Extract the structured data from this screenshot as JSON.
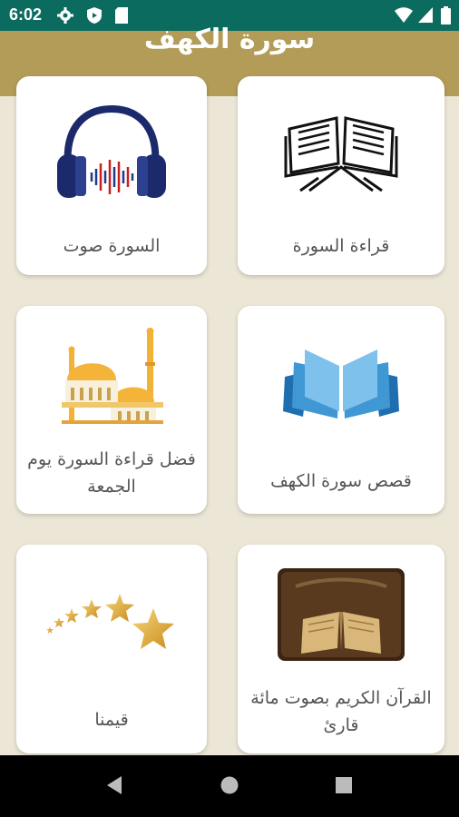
{
  "status_bar": {
    "time": "6:02",
    "left_icons": [
      "gear-icon",
      "shield-icon",
      "sd-card-icon"
    ],
    "right_icons": [
      "wifi-icon",
      "signal-icon",
      "battery-icon"
    ]
  },
  "app_bar": {
    "title": "سورة الكهف"
  },
  "cards": [
    {
      "label": "قراءة السورة",
      "icon": "quran-book-icon"
    },
    {
      "label": "السورة صوت",
      "icon": "headphones-icon"
    },
    {
      "label": "قصص سورة الكهف",
      "icon": "open-book-icon"
    },
    {
      "label": "فضل قراءة السورة يوم الجمعة",
      "icon": "mosque-icon"
    },
    {
      "label": "القرآن الكريم بصوت مائة قارئ",
      "icon": "quran-image-icon"
    },
    {
      "label": "قيمنا",
      "icon": "stars-icon"
    }
  ],
  "nav_bar": {
    "icons": [
      "back-icon",
      "home-icon",
      "recents-icon"
    ]
  },
  "colors": {
    "status_bar": "#0b6b5e",
    "app_bar": "#b39b58",
    "background": "#ece6d6",
    "card": "#ffffff"
  }
}
